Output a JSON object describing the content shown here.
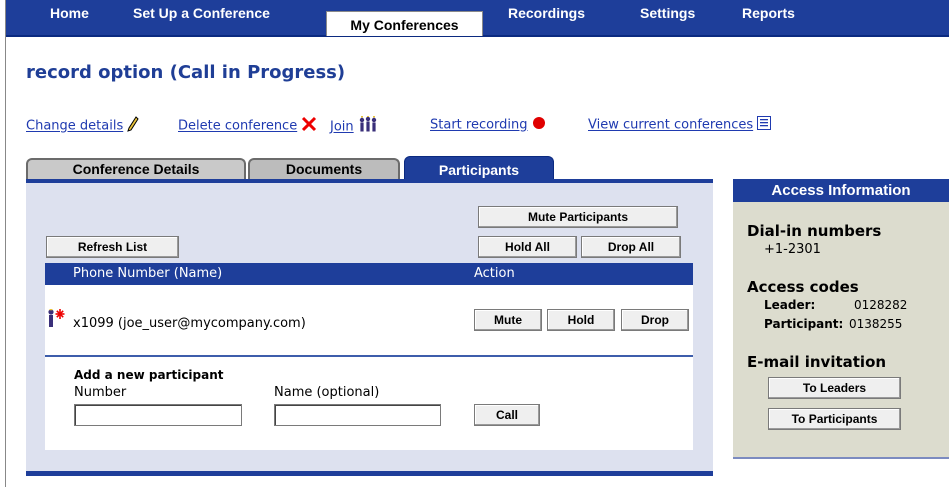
{
  "nav": {
    "items": [
      "Home",
      "Set Up a Conference",
      "My Conferences",
      "Recordings",
      "Settings",
      "Reports"
    ],
    "active": "My Conferences"
  },
  "page_title": "record option (Call in Progress)",
  "actions": {
    "change_details": "Change details",
    "delete_conference": "Delete conference",
    "join": "Join",
    "start_recording": "Start recording",
    "view_current": "View current conferences"
  },
  "tabs": [
    "Conference Details",
    "Documents",
    "Participants"
  ],
  "participants": {
    "mute_participants": "Mute Participants",
    "refresh_list": "Refresh List",
    "hold_all": "Hold All",
    "drop_all": "Drop All",
    "col_phone": "Phone Number (Name)",
    "col_action": "Action",
    "rows": [
      {
        "phone": "x1099 (joe_user@mycompany.com)",
        "mute": "Mute",
        "hold": "Hold",
        "drop": "Drop"
      }
    ],
    "add_heading": "Add a new participant",
    "number_label": "Number",
    "name_label": "Name (optional)",
    "number_value": "",
    "name_value": "",
    "call": "Call"
  },
  "access": {
    "header": "Access Information",
    "dialin_heading": "Dial-in numbers",
    "dialin_number": "+1-2301",
    "codes_heading": "Access codes",
    "leader_label": "Leader:",
    "leader_code": "0128282",
    "participant_label": "Participant:",
    "participant_code": "0138255",
    "email_heading": "E-mail invitation",
    "to_leaders": "To Leaders",
    "to_participants": "To Participants"
  },
  "colors": {
    "brand_blue": "#1e3e9a",
    "panel_bg": "#dde1ef",
    "access_bg": "#dcdcce",
    "link": "#1f3ab0"
  }
}
